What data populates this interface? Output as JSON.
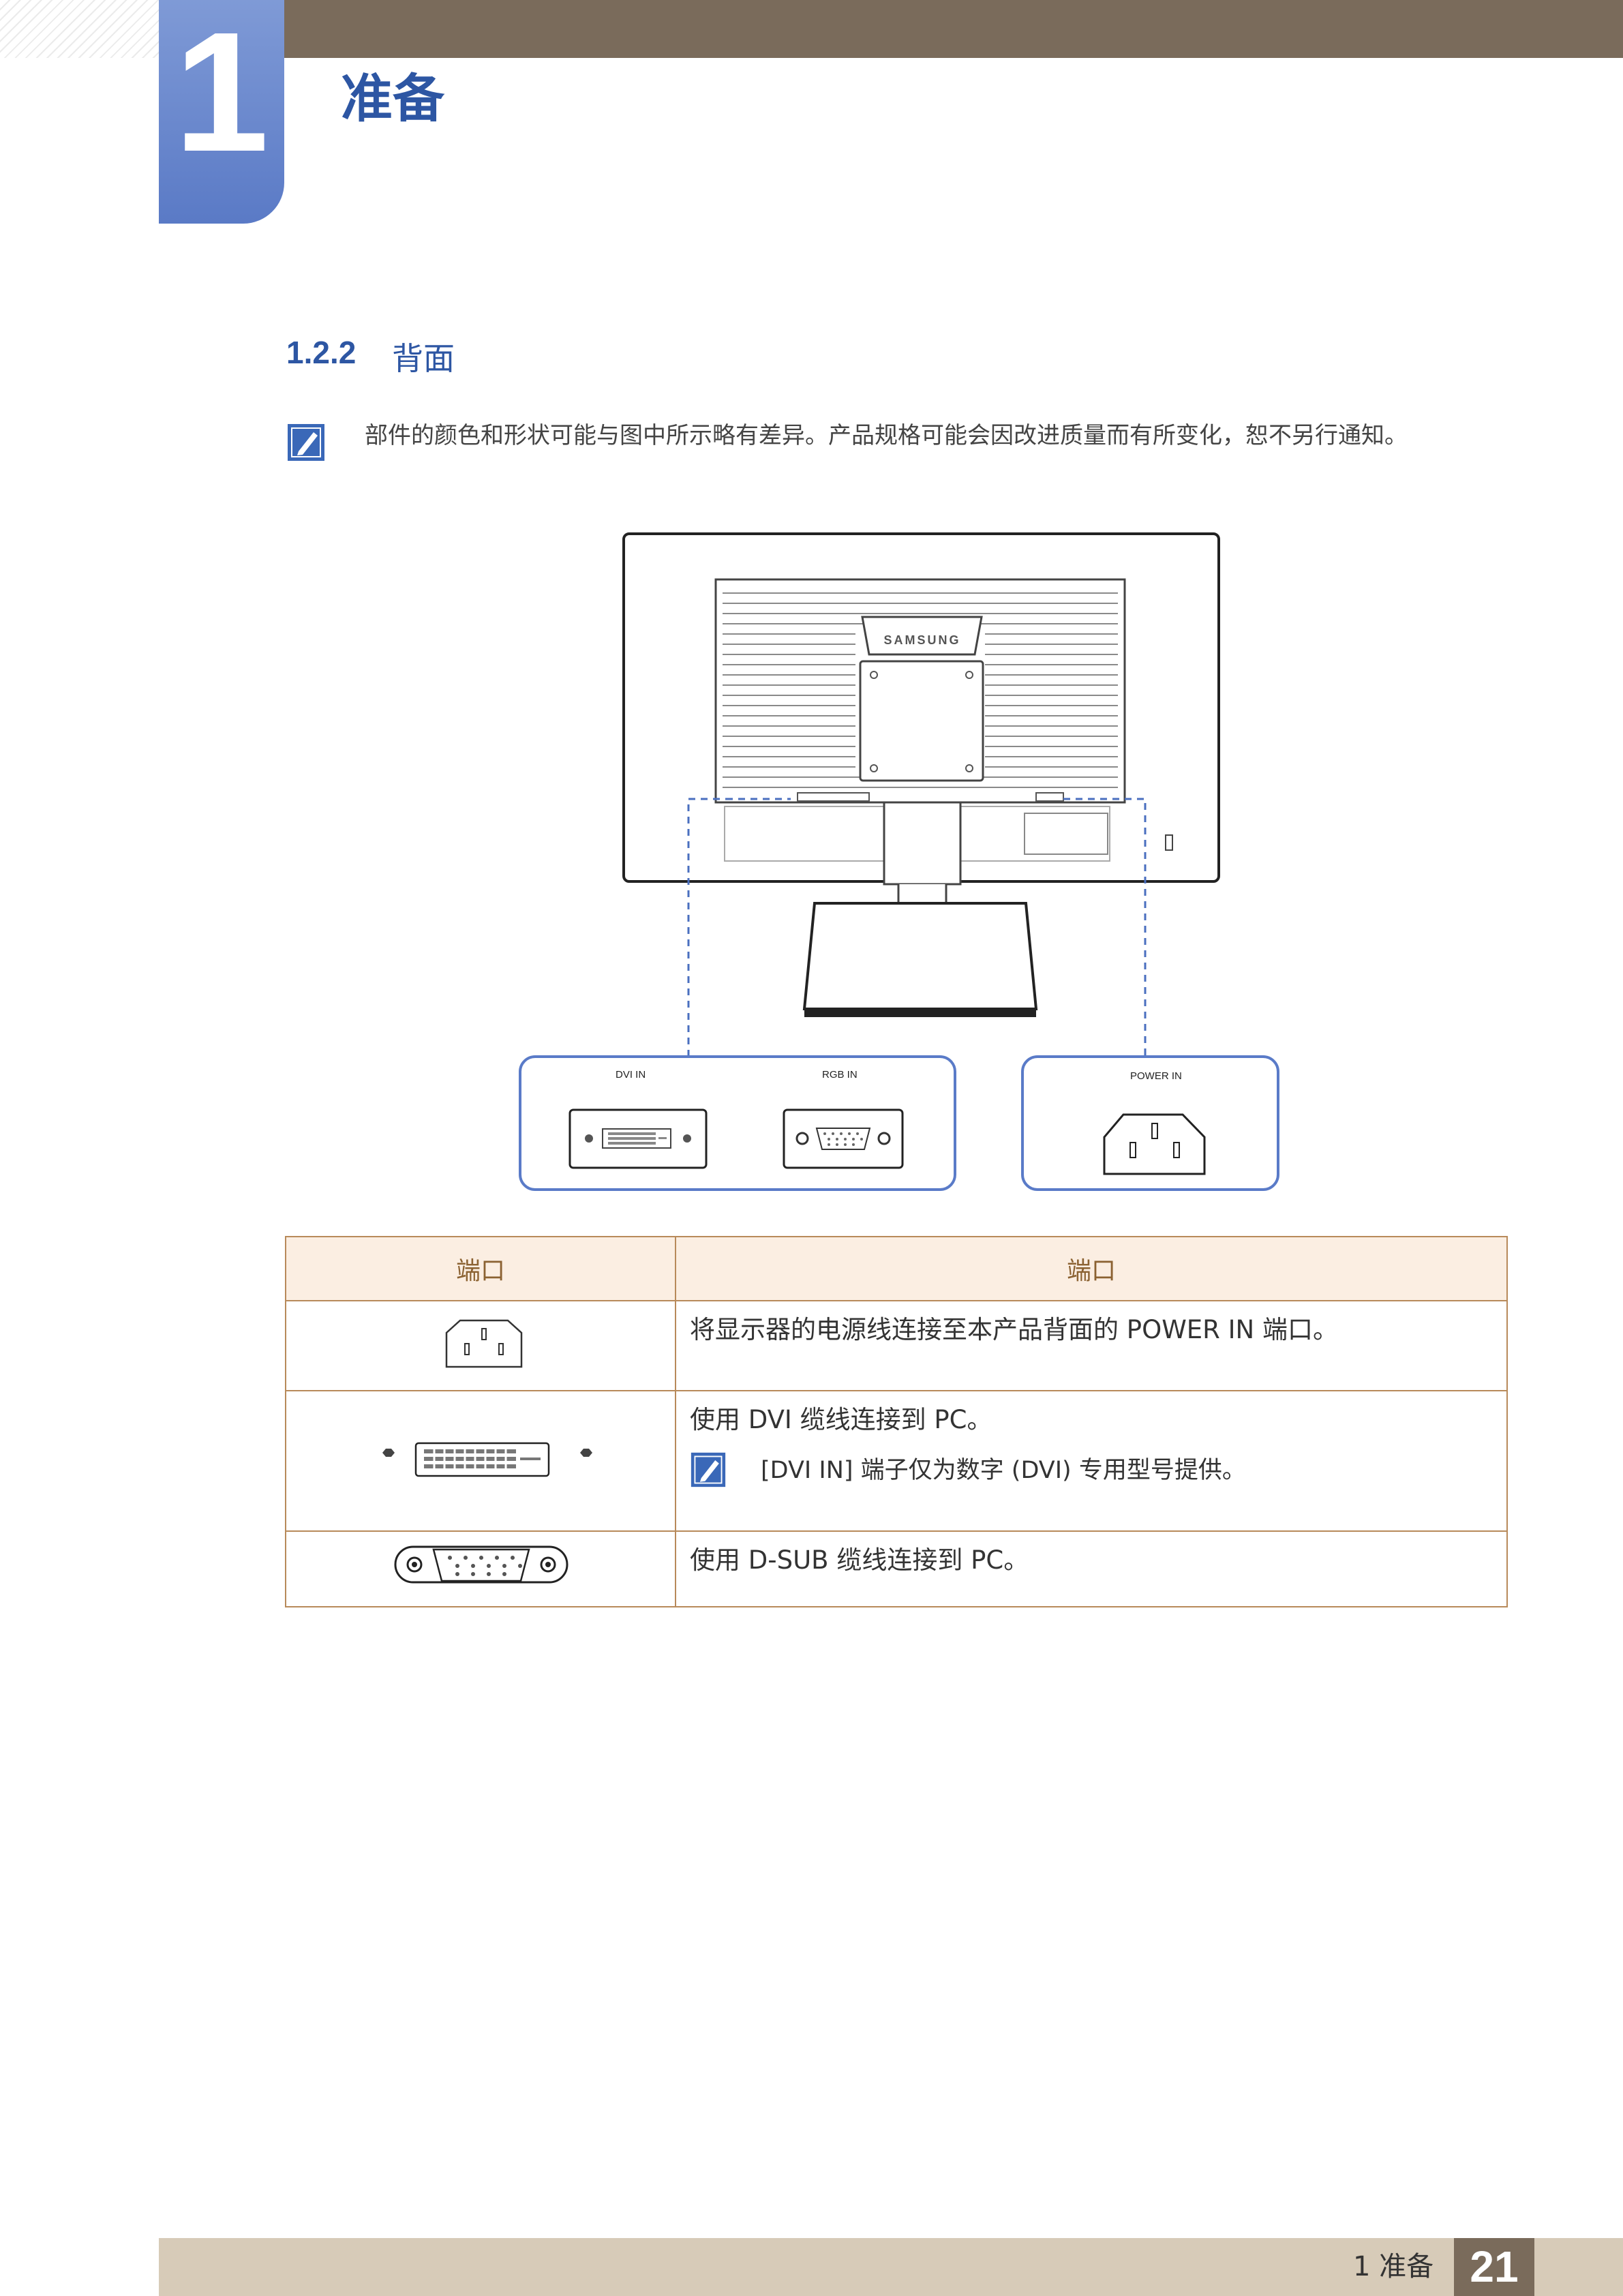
{
  "header": {
    "chapter_number": "1",
    "chapter_title": "准备"
  },
  "section": {
    "number": "1.2.2",
    "title": "背面"
  },
  "note": {
    "text": "部件的颜色和形状可能与图中所示略有差异。产品规格可能会因改进质量而有所变化，恕不另行通知。",
    "icon": "note-pencil-icon"
  },
  "diagram": {
    "brand": "SAMSUNG",
    "ports": [
      {
        "label": "DVI IN"
      },
      {
        "label": "RGB IN"
      },
      {
        "label": "POWER IN"
      }
    ]
  },
  "table": {
    "headers": [
      "端口",
      "端口"
    ],
    "rows": [
      {
        "icon": "power-connector-icon",
        "description": "将显示器的电源线连接至本产品背面的 POWER IN 端口。"
      },
      {
        "icon": "dvi-connector-icon",
        "description": "使用 DVI 缆线连接到 PC。",
        "note": "[DVI IN] 端子仅为数字 (DVI) 专用型号提供。"
      },
      {
        "icon": "dsub-connector-icon",
        "description": "使用 D-SUB 缆线连接到 PC。"
      }
    ]
  },
  "footer": {
    "chapter_label": "1 准备",
    "page_number": "21"
  },
  "colors": {
    "accent_blue": "#2d56a3",
    "header_brown": "#7a6b5b",
    "table_border": "#b88a5a",
    "table_header_bg": "#fbeee2",
    "footer_bg": "#d7cbb8"
  }
}
